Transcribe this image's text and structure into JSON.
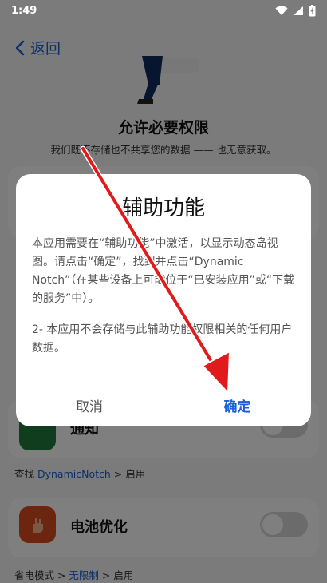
{
  "status_bar": {
    "time": "1:49"
  },
  "header": {
    "back_label": "返回"
  },
  "permissions": {
    "title": "允许必要权限",
    "subtitle": "我们既不存储也不共享您的数据 —— 也无意获取。"
  },
  "rows": {
    "notification": {
      "label": "通知",
      "hint_prefix": "查找 ",
      "hint_link": "DynamicNotch",
      "hint_suffix": " > 启用"
    },
    "battery": {
      "label": "电池优化",
      "hint_prefix": "省电模式 > ",
      "hint_link": "无限制",
      "hint_suffix": " > 启用"
    }
  },
  "dialog": {
    "title": "辅助功能",
    "paragraph1": "本应用需要在“辅助功能”中激活，以显示动态岛视图。请点击“确定”，找到并点击“Dynamic Notch”（在某些设备上可能位于“已安装应用”或“下载的服务”中）。",
    "paragraph2": "2- 本应用不会存储与此辅助功能权限相关的任何用户数据。",
    "cancel_label": "取消",
    "confirm_label": "确定"
  },
  "colors": {
    "accent": "#1a5fd6",
    "annotation_arrow": "#e11b1b"
  }
}
